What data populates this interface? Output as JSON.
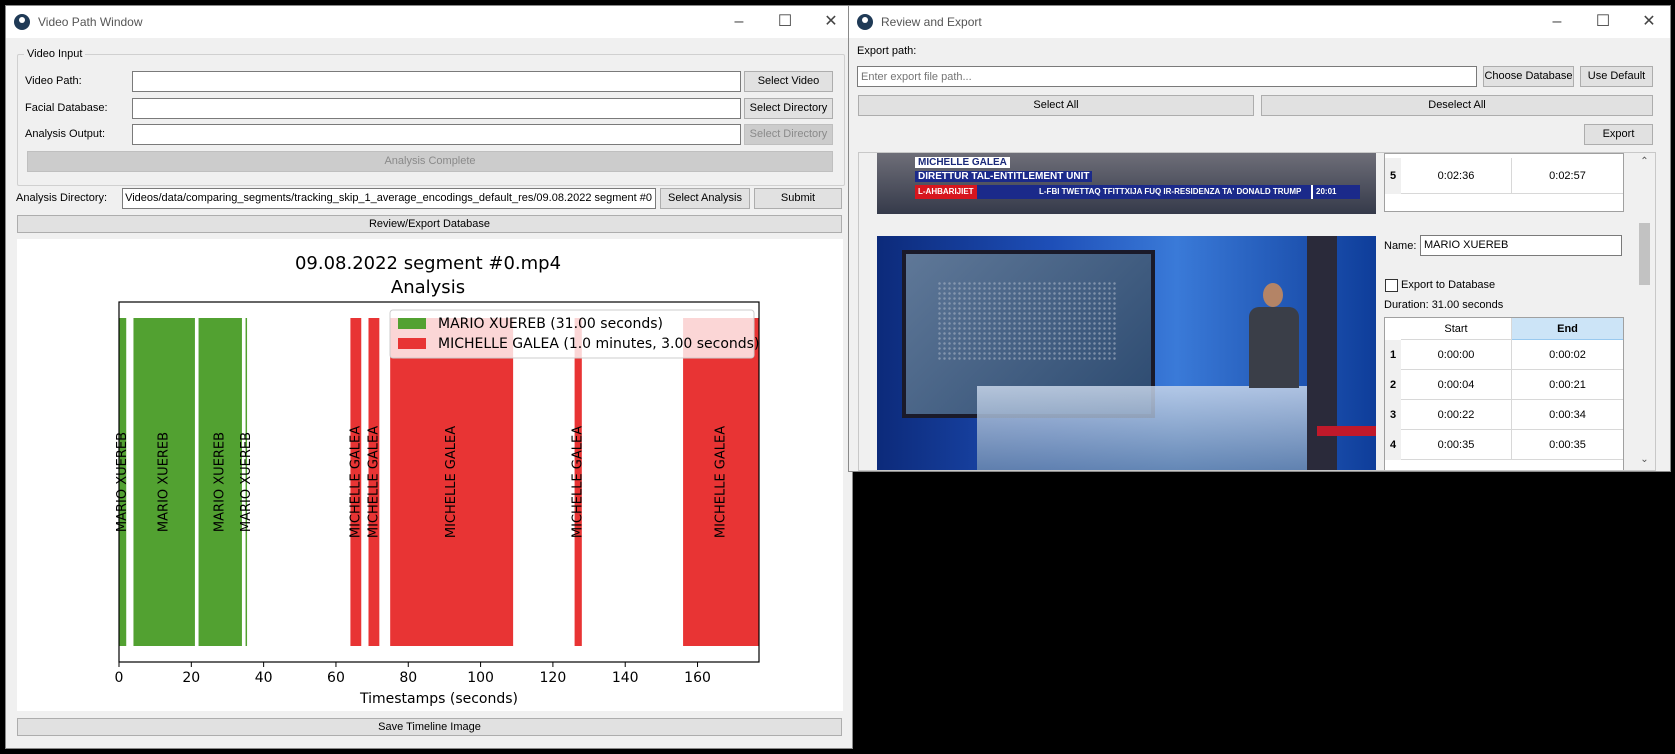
{
  "left_window": {
    "title": "Video Path Window",
    "group_title": "Video Input",
    "video_path_label": "Video Path:",
    "video_path_value": "",
    "select_video": "Select Video",
    "facial_db_label": "Facial Database:",
    "facial_db_value": "",
    "select_directory": "Select Directory",
    "analysis_output_label": "Analysis Output:",
    "analysis_output_value": "",
    "select_directory_disabled": "Select Directory",
    "analysis_complete": "Analysis Complete",
    "analysis_dir_label": "Analysis Directory:",
    "analysis_dir_value": "Videos/data/comparing_segments/tracking_skip_1_average_encodings_default_res/09.08.2022 segment #0",
    "select_analysis": "Select Analysis",
    "submit": "Submit",
    "review_export": "Review/Export Database",
    "save_timeline": "Save Timeline Image"
  },
  "chart_data": {
    "type": "bar",
    "title": "09.08.2022 segment #0.mp4",
    "subtitle": "Analysis",
    "xlabel": "Timestamps (seconds)",
    "ylabel": "",
    "xlim": [
      0,
      177
    ],
    "xticks": [
      "0",
      "20",
      "40",
      "60",
      "80",
      "100",
      "120",
      "140",
      "160"
    ],
    "xtick_values": [
      0,
      20,
      40,
      60,
      80,
      100,
      120,
      140,
      160
    ],
    "legend_position": "top-right",
    "series": [
      {
        "name": "MARIO XUEREB (31.00 seconds)",
        "label": "MARIO XUEREB",
        "color": "#52a131",
        "segments": [
          [
            0,
            2
          ],
          [
            4,
            21
          ],
          [
            22,
            34
          ],
          [
            35,
            35
          ]
        ]
      },
      {
        "name": "MICHELLE GALEA (1.0 minutes, 3.00 seconds)",
        "label": "MICHELLE GALEA",
        "color": "#e83434",
        "segments": [
          [
            64,
            67
          ],
          [
            69,
            72
          ],
          [
            75,
            109
          ],
          [
            126,
            128
          ],
          [
            156,
            177
          ]
        ]
      }
    ]
  },
  "right_window": {
    "title": "Review and Export",
    "export_path_label": "Export path:",
    "export_path_placeholder": "Enter export file path...",
    "choose_database": "Choose Database",
    "use_default": "Use Default",
    "select_all": "Select All",
    "deselect_all": "Deselect All",
    "export": "Export",
    "prev_entry": {
      "caption_name": "MICHELLE GALEA",
      "caption_role": "DIRETTUR TAL-ENTITLEMENT UNIT",
      "caption_tag": "L-AHBARIJIET",
      "caption_ticker": "L-FBI TWETTAQ TFITTXIJA FUQ IR-RESIDENZA TA' DONALD TRUMP",
      "caption_time": "20:01",
      "row": {
        "index": "5",
        "start": "0:02:36",
        "end": "0:02:57"
      }
    },
    "entry": {
      "name_label": "Name:",
      "name_value": "MARIO XUEREB",
      "export_checkbox": "Export to Database",
      "duration": "Duration: 31.00 seconds",
      "col_start": "Start",
      "col_end": "End",
      "rows": [
        {
          "index": "1",
          "start": "0:00:00",
          "end": "0:00:02"
        },
        {
          "index": "2",
          "start": "0:00:04",
          "end": "0:00:21"
        },
        {
          "index": "3",
          "start": "0:00:22",
          "end": "0:00:34"
        },
        {
          "index": "4",
          "start": "0:00:35",
          "end": "0:00:35"
        }
      ]
    }
  }
}
